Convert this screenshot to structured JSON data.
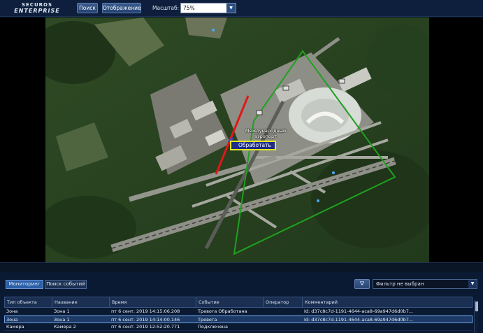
{
  "app": {
    "logo_line1": "SECUROS",
    "logo_line2": "ENTERPRISE"
  },
  "toolbar": {
    "search_label": "Поиск",
    "display_label": "Отображение",
    "scale_label": "Масштаб:",
    "scale_value": "75%"
  },
  "map": {
    "place_label_line1": "Международный",
    "place_label_line2": "аэропорт",
    "context_menu_item": "Обработать",
    "colors": {
      "zone_red": "#e01818",
      "zone_green": "#1fa01f",
      "zone_blue": "#3a48d8",
      "highlight": "#e8e820"
    }
  },
  "events_panel": {
    "tabs": [
      {
        "label": "Мониторинг",
        "active": true
      },
      {
        "label": "Поиск событий",
        "active": false
      }
    ],
    "filter_icon": "filter-icon",
    "filter_value": "Фильтр не выбран",
    "columns": [
      "Тип объекта",
      "Название",
      "Время",
      "Событие",
      "Оператор",
      "Комментарий"
    ],
    "rows": [
      {
        "type": "Зона",
        "name": "Зона 1",
        "time": "пт 6 сент. 2019  14:15:06.208",
        "event": "Тревога Обработана",
        "operator": "",
        "comment": "Id: d37c8c7d-1191-4644-aca8-69a947d6d0b7..."
      },
      {
        "type": "Зона",
        "name": "Зона 1",
        "time": "пт 6 сент. 2019  14:14:00.146",
        "event": "Тревога",
        "operator": "",
        "comment": "Id: d37c8c7d-1191-4644-aca8-69a947d6d0b7..."
      },
      {
        "type": "Камера",
        "name": "Камера 2",
        "time": "пт 6 сент. 2019  12:52:20.771",
        "event": "Подключена",
        "operator": "",
        "comment": ""
      }
    ]
  }
}
